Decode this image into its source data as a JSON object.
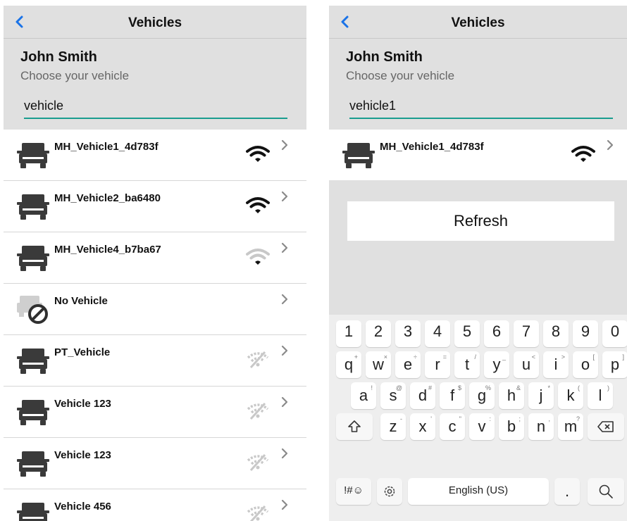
{
  "left": {
    "nav": {
      "title": "Vehicles"
    },
    "header": {
      "name": "John Smith",
      "subtitle": "Choose your vehicle",
      "search_value": "vehicle"
    },
    "vehicles": [
      {
        "name": "MH_Vehicle1_4d783f",
        "signal": "strong"
      },
      {
        "name": "MH_Vehicle2_ba6480",
        "signal": "strong"
      },
      {
        "name": "MH_Vehicle4_b7ba67",
        "signal": "weak"
      },
      {
        "name": "No Vehicle",
        "signal": "none"
      },
      {
        "name": "PT_Vehicle",
        "signal": "off"
      },
      {
        "name": "Vehicle 123",
        "signal": "off"
      },
      {
        "name": "Vehicle 123",
        "signal": "off"
      },
      {
        "name": "Vehicle 456",
        "signal": "off"
      }
    ]
  },
  "right": {
    "nav": {
      "title": "Vehicles"
    },
    "header": {
      "name": "John Smith",
      "subtitle": "Choose your vehicle",
      "search_value": "vehicle1"
    },
    "vehicles": [
      {
        "name": "MH_Vehicle1_4d783f",
        "signal": "strong"
      }
    ],
    "refresh_label": "Refresh"
  },
  "keyboard": {
    "number_row": [
      "1",
      "2",
      "3",
      "4",
      "5",
      "6",
      "7",
      "8",
      "9",
      "0"
    ],
    "row1": [
      {
        "key": "q",
        "hint": "+"
      },
      {
        "key": "w",
        "hint": "×"
      },
      {
        "key": "e",
        "hint": "÷"
      },
      {
        "key": "r",
        "hint": "="
      },
      {
        "key": "t",
        "hint": "/"
      },
      {
        "key": "y",
        "hint": "_"
      },
      {
        "key": "u",
        "hint": "<"
      },
      {
        "key": "i",
        "hint": ">"
      },
      {
        "key": "o",
        "hint": "["
      },
      {
        "key": "p",
        "hint": "]"
      }
    ],
    "row2": [
      {
        "key": "a",
        "hint": "!"
      },
      {
        "key": "s",
        "hint": "@"
      },
      {
        "key": "d",
        "hint": "#"
      },
      {
        "key": "f",
        "hint": "$"
      },
      {
        "key": "g",
        "hint": "%"
      },
      {
        "key": "h",
        "hint": "&"
      },
      {
        "key": "j",
        "hint": "*"
      },
      {
        "key": "k",
        "hint": "("
      },
      {
        "key": "l",
        "hint": ")"
      }
    ],
    "row3": [
      {
        "key": "z",
        "hint": "-"
      },
      {
        "key": "x",
        "hint": "'"
      },
      {
        "key": "c",
        "hint": "\""
      },
      {
        "key": "v",
        "hint": ":"
      },
      {
        "key": "b",
        "hint": ";"
      },
      {
        "key": "n",
        "hint": ","
      },
      {
        "key": "m",
        "hint": "?"
      }
    ],
    "symbols_label": "!#☺",
    "space_label": "English (US)",
    "period_label": "."
  },
  "colors": {
    "accent": "#1a9d8f",
    "back": "#1a73e8",
    "header_bg": "#e0e0e0"
  }
}
